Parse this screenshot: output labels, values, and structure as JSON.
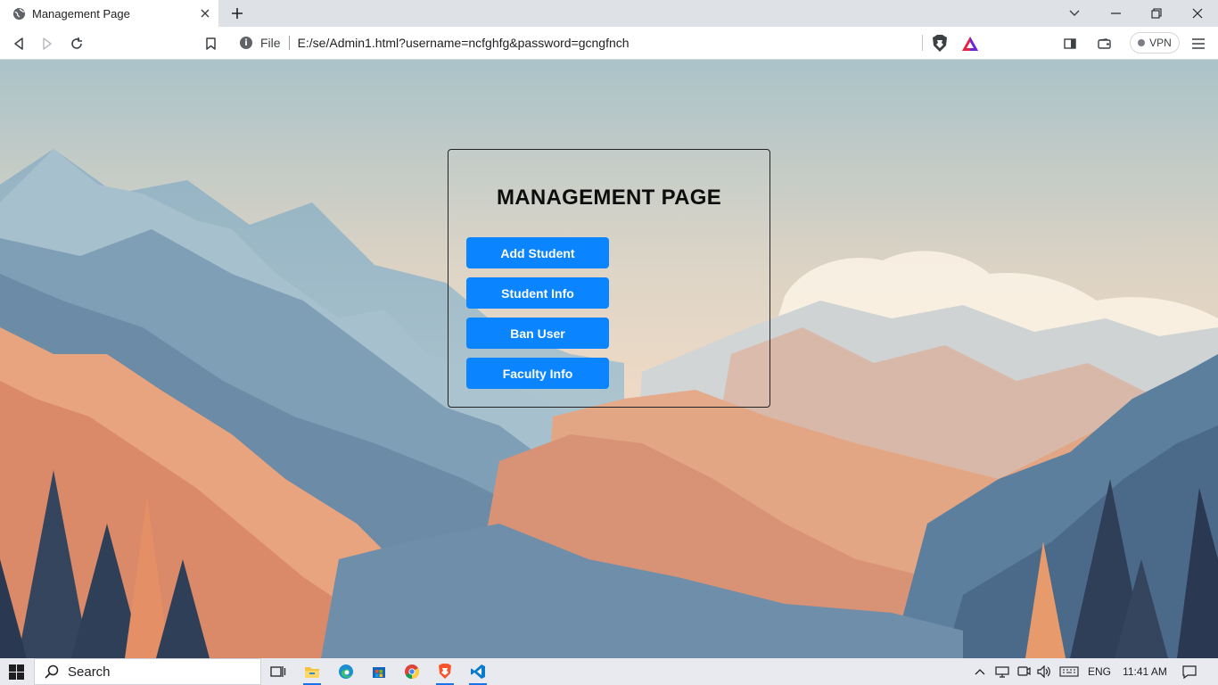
{
  "browser": {
    "tab": {
      "title": "Management Page"
    },
    "address": {
      "scheme": "File",
      "url": "E:/se/Admin1.html?username=ncfghfg&password=gcngfnch"
    },
    "vpn_label": "VPN"
  },
  "page": {
    "heading": "MANAGEMENT PAGE",
    "buttons": [
      {
        "label": "Add Student"
      },
      {
        "label": "Student Info"
      },
      {
        "label": "Ban User"
      },
      {
        "label": "Faculty Info"
      }
    ],
    "button_color": "#0a84ff"
  },
  "taskbar": {
    "search_label": "Search",
    "language": "ENG",
    "time": "11:41 AM",
    "apps": [
      "task-view-icon",
      "file-explorer-icon",
      "edge-icon",
      "store-icon",
      "chrome-icon",
      "brave-icon",
      "vscode-icon"
    ]
  }
}
